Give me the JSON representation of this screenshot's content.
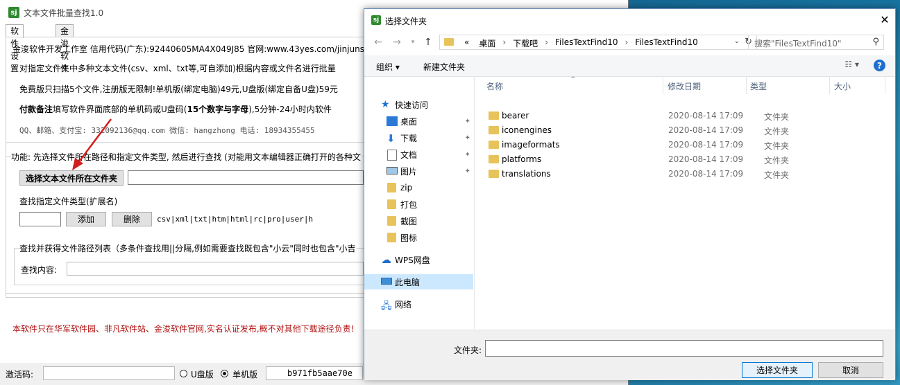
{
  "app": {
    "title": "文本文件批量查找1.0",
    "logo_text": "sj",
    "tabs": [
      "软件设置",
      "金浚软件"
    ],
    "line_company": "金浚软件开发工作室 信用代码(广东):92440605MA4X049J85 官网:www.43yes.com/jinjunsoft",
    "line_desc": "对指定文件夹中多种文本文件(csv、xml、txt等,可自添加)根据内容或文件名进行批量",
    "line_free": "免费版只扫描5个文件,注册版无限制!单机版(绑定电脑)49元,U盘版(绑定自备U盘)59元",
    "line_pay_bold": "付款备注",
    "line_pay_rest": "填写软件界面底部的单机码或U盘码(",
    "line_pay_bold2": "15个数字与字母",
    "line_pay_rest2": "),5分钟-24小时内软件",
    "line_contact": "QQ、邮箱、支付宝: 332092136@qq.com    微信: hangzhong    电话: 18934355455",
    "function_text": "功能: 先选择文件所在路径和指定文件类型, 然后进行查找 (对能用文本编辑器正确打开的各种文",
    "select_folder_button": "选择文本文件所在文件夹",
    "ext_label": "查找指定文件类型(扩展名)",
    "add_button": "添加",
    "delete_button": "删除",
    "ext_list": "csv|xml|txt|htm|html|rc|pro|user|h",
    "search_group_title": "查找并获得文件路径列表（多条件查找用||分隔,例如需要查找既包含\"小云\"同时也包含\"小吉",
    "search_label": "查找内容:",
    "red_note": "本软件只在华军软件园、非凡软件站、金浚软件官网,实名认证发布,概不对其他下载途径负责!",
    "activation_label": "激活码:",
    "radio_usb": "U盘版",
    "radio_single": "单机版",
    "machine_code": "b971fb5aae70e"
  },
  "dialog": {
    "title": "选择文件夹",
    "breadcrumb_prefix": "«",
    "breadcrumbs": [
      "桌面",
      "下载吧",
      "FilesTextFind10",
      "FilesTextFind10"
    ],
    "search_placeholder": "搜索\"FilesTextFind10\"",
    "toolbar": {
      "organize": "组织 ▾",
      "new_folder": "新建文件夹"
    },
    "nav": {
      "quick_access": "快速访问",
      "items": [
        "桌面",
        "下载",
        "文档",
        "图片",
        "zip",
        "打包",
        "截图",
        "图标"
      ],
      "wps": "WPS网盘",
      "this_pc": "此电脑",
      "network": "网络"
    },
    "columns": {
      "name": "名称",
      "date": "修改日期",
      "type": "类型",
      "size": "大小"
    },
    "files": [
      {
        "name": "bearer",
        "date": "2020-08-14 17:09",
        "type": "文件夹"
      },
      {
        "name": "iconengines",
        "date": "2020-08-14 17:09",
        "type": "文件夹"
      },
      {
        "name": "imageformats",
        "date": "2020-08-14 17:09",
        "type": "文件夹"
      },
      {
        "name": "platforms",
        "date": "2020-08-14 17:09",
        "type": "文件夹"
      },
      {
        "name": "translations",
        "date": "2020-08-14 17:09",
        "type": "文件夹"
      }
    ],
    "folder_label": "文件夹:",
    "select_button": "选择文件夹",
    "cancel_button": "取消"
  },
  "colors": {
    "accent": "#0078d7",
    "folder": "#e8c35b",
    "red_note": "#b01010",
    "nav_selected": "#cce8ff"
  }
}
